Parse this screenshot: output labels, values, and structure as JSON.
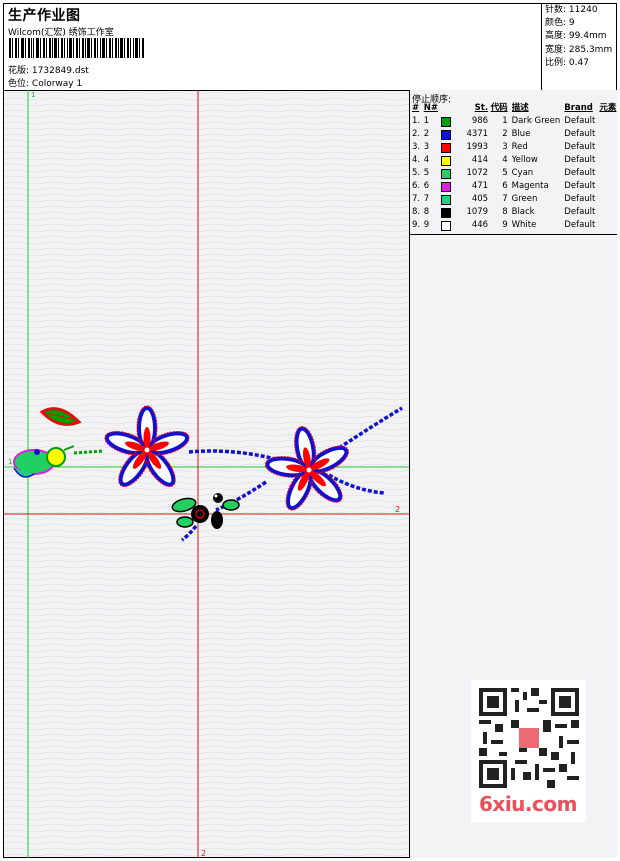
{
  "header": {
    "title": "生产作业图",
    "company": "Wilcom(汇宏) 绣饰工作室",
    "design_label": "花版:",
    "design_value": "1732849.dst",
    "colorway_label": "色位:",
    "colorway_value": "Colorway 1"
  },
  "stats": [
    {
      "label": "针数:",
      "value": "11240"
    },
    {
      "label": "颜色:",
      "value": "9"
    },
    {
      "label": "高度:",
      "value": "99.4mm"
    },
    {
      "label": "宽度:",
      "value": "285.3mm"
    },
    {
      "label": "比例:",
      "value": "0.47"
    }
  ],
  "canvas": {
    "marker_1_top": "1",
    "marker_1_left": "1",
    "marker_2_right": "2",
    "marker_2_bottom": "2",
    "colors": {
      "green_guide": "#22cc22",
      "red_guide": "#dd1111"
    }
  },
  "stop_sequence": {
    "title": "停止顺序:",
    "headers": {
      "hash": "#",
      "n": "N#",
      "st": "St.",
      "code": "代码",
      "desc": "描述",
      "brand": "Brand",
      "elem": "元素"
    },
    "rows": [
      {
        "hash": "1.",
        "n": "1",
        "color": "#00a000",
        "st": "986",
        "code": "1",
        "desc": "Dark Green",
        "brand": "Default"
      },
      {
        "hash": "2.",
        "n": "2",
        "color": "#1010d0",
        "st": "4371",
        "code": "2",
        "desc": "Blue",
        "brand": "Default"
      },
      {
        "hash": "3.",
        "n": "3",
        "color": "#ff0000",
        "st": "1993",
        "code": "3",
        "desc": "Red",
        "brand": "Default"
      },
      {
        "hash": "4.",
        "n": "4",
        "color": "#ffff00",
        "st": "414",
        "code": "4",
        "desc": "Yellow",
        "brand": "Default"
      },
      {
        "hash": "5.",
        "n": "5",
        "color": "#20d060",
        "st": "1072",
        "code": "5",
        "desc": "Cyan",
        "brand": "Default"
      },
      {
        "hash": "6.",
        "n": "6",
        "color": "#e020e0",
        "st": "471",
        "code": "6",
        "desc": "Magenta",
        "brand": "Default"
      },
      {
        "hash": "7.",
        "n": "7",
        "color": "#20d080",
        "st": "405",
        "code": "7",
        "desc": "Green",
        "brand": "Default"
      },
      {
        "hash": "8.",
        "n": "8",
        "color": "#000000",
        "st": "1079",
        "code": "8",
        "desc": "Black",
        "brand": "Default"
      },
      {
        "hash": "9.",
        "n": "9",
        "color": "#ffffff",
        "st": "446",
        "code": "9",
        "desc": "White",
        "brand": "Default"
      }
    ]
  },
  "watermark": {
    "site": "6xiu.com",
    "qr_icon": "qr-code-icon",
    "accent": "#e8505b"
  }
}
